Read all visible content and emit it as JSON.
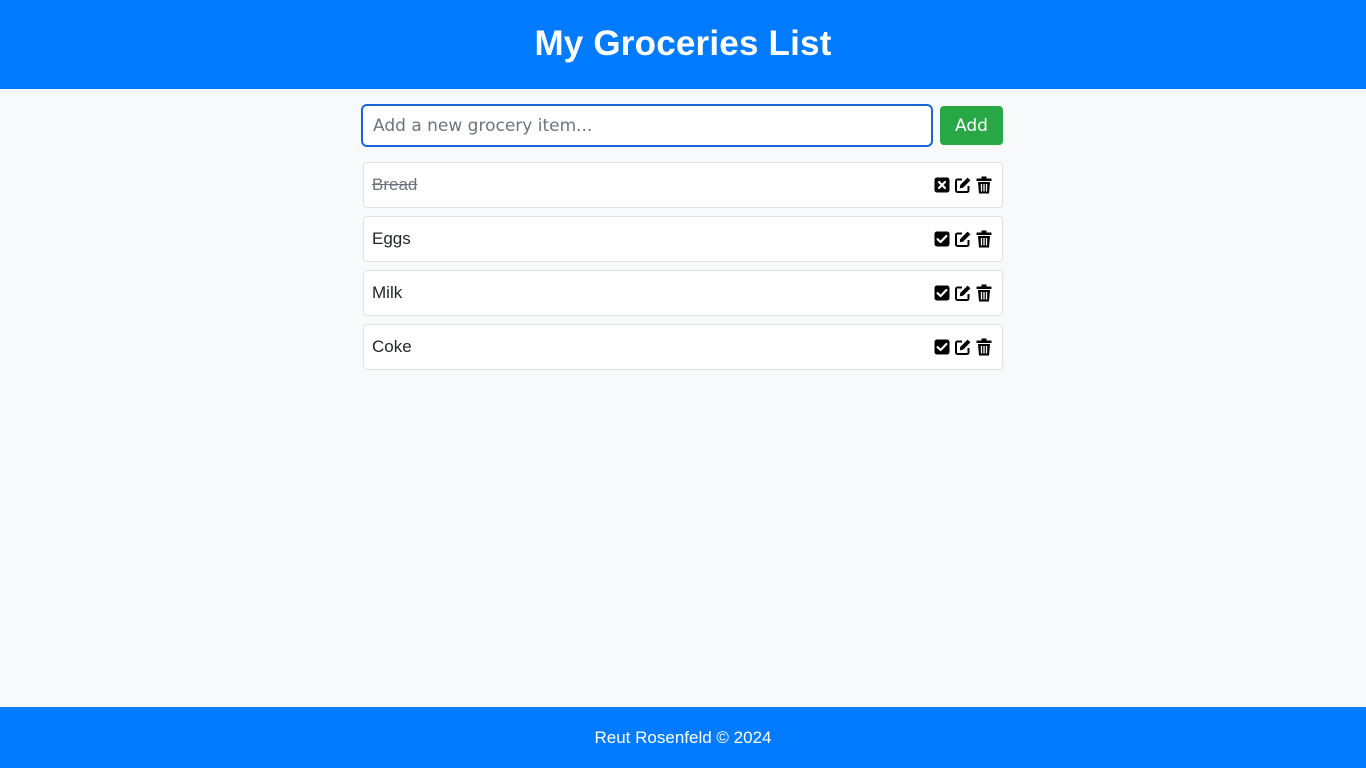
{
  "header": {
    "title": "My Groceries List"
  },
  "form": {
    "input_value": "",
    "input_placeholder": "Add a new grocery item...",
    "add_label": "Add"
  },
  "items": [
    {
      "label": "Bread",
      "done": true,
      "toggle_icon": "x-square-icon"
    },
    {
      "label": "Eggs",
      "done": false,
      "toggle_icon": "check-square-icon"
    },
    {
      "label": "Milk",
      "done": false,
      "toggle_icon": "check-square-icon"
    },
    {
      "label": "Coke",
      "done": false,
      "toggle_icon": "check-square-icon"
    }
  ],
  "icons": {
    "edit": "edit-icon",
    "delete": "trash-icon"
  },
  "colors": {
    "brand": "#007bff",
    "add_button": "#28a745",
    "background": "#f8f9fa",
    "done_text": "#6c757d"
  },
  "footer": {
    "text": "Reut Rosenfeld © 2024"
  }
}
